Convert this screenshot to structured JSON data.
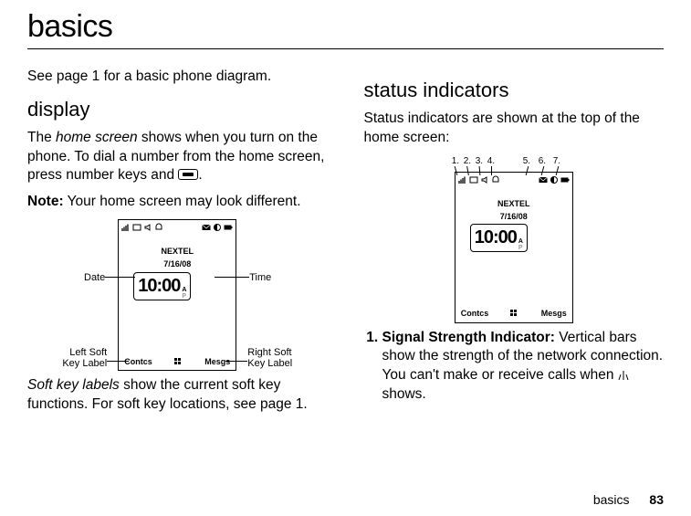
{
  "title": "basics",
  "left": {
    "intro": "See page 1 for a basic phone diagram.",
    "heading": "display",
    "p1a": "The ",
    "p1_em": "home screen",
    "p1b": " shows when you turn on the phone. To dial a number from the home screen, press number keys and ",
    "p1c": ".",
    "note_label": "Note:",
    "note_text": " Your home screen may look different.",
    "callouts": {
      "date": "Date",
      "time": "Time",
      "leftsoft_l1": "Left Soft",
      "leftsoft_l2": "Key Label",
      "rightsoft_l1": "Right Soft",
      "rightsoft_l2": "Key Label"
    },
    "p2a": "Soft key labels",
    "p2b": " show the current soft key functions. For soft key locations, see page 1."
  },
  "right": {
    "heading": "status indicators",
    "p1": "Status indicators are shown at the top of the home screen:",
    "nums": [
      "1.",
      "2.",
      "3.",
      "4.",
      "5.",
      "6.",
      "7."
    ],
    "item1_num": "1",
    "item1_label": "Signal Strength Indicator:",
    "item1_text_a": " Vertical bars show the strength of the network connection. You can't make or receive calls when ",
    "item1_text_b": " shows."
  },
  "phone": {
    "carrier": "NEXTEL",
    "date": "7/16/08",
    "time": "10:00",
    "am": "A",
    "pm": "P",
    "left_soft": "Contcs",
    "right_soft": "Mesgs"
  },
  "footer": {
    "section": "basics",
    "page": "83"
  }
}
